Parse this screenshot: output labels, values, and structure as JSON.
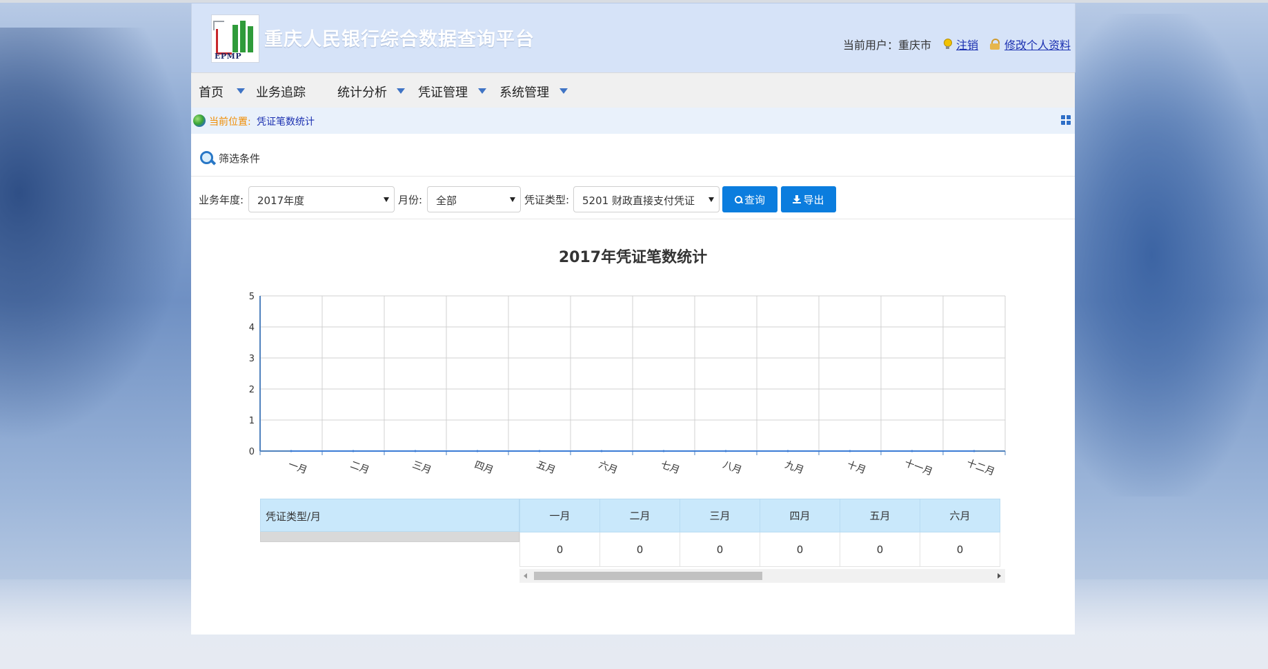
{
  "header": {
    "logo_text": "EPMP",
    "site_title": "重庆人民银行综合数据查询平台",
    "user_label": "当前用户：重庆市",
    "logout_label": "注销",
    "profile_label": "修改个人资料"
  },
  "nav": {
    "items": [
      {
        "label": "首页"
      },
      {
        "label": "业务追踪"
      },
      {
        "label": "统计分析"
      },
      {
        "label": "凭证管理"
      },
      {
        "label": "系统管理"
      }
    ]
  },
  "breadcrumb": {
    "label": "当前位置:",
    "current": "凭证笔数统计"
  },
  "filter": {
    "title": "筛选条件",
    "year_label": "业务年度:",
    "year_value": "2017年度",
    "month_label": "月份:",
    "month_value": "全部",
    "type_label": "凭证类型:",
    "type_value": "5201 财政直接支付凭证",
    "query_label": "查询",
    "export_label": "导出"
  },
  "chart_data": {
    "type": "line",
    "title": "2017年凭证笔数统计",
    "categories": [
      "一月",
      "二月",
      "三月",
      "四月",
      "五月",
      "六月",
      "七月",
      "八月",
      "九月",
      "十月",
      "十一月",
      "十二月"
    ],
    "values": [
      0,
      0,
      0,
      0,
      0,
      0,
      0,
      0,
      0,
      0,
      0,
      0
    ],
    "ylim": [
      0,
      5
    ],
    "yticks": [
      0,
      1,
      2,
      3,
      4,
      5
    ],
    "grid": true,
    "colors": {
      "line": "#3a7bd5",
      "axis": "#4f81bd",
      "grid": "#d0d0d0"
    }
  },
  "table": {
    "corner_header": "凭证类型/月",
    "columns": [
      "一月",
      "二月",
      "三月",
      "四月",
      "五月",
      "六月"
    ],
    "row_values": [
      "0",
      "0",
      "0",
      "0",
      "0",
      "0"
    ]
  },
  "colors": {
    "header_bg": "#d6e3f8",
    "accent_button": "#0b7dde",
    "table_header_bg": "#c9e8fb",
    "breadcrumb_label": "#f08c00",
    "link": "#1a2fb0"
  }
}
